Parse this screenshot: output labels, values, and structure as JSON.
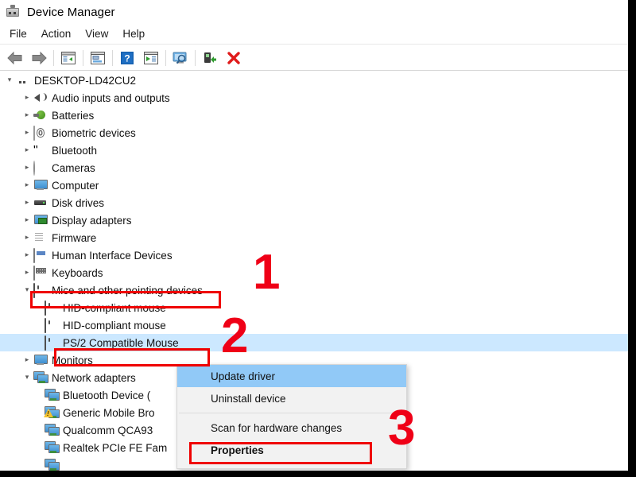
{
  "window": {
    "title": "Device Manager",
    "app_icon": "device-manager-icon"
  },
  "menubar": {
    "items": [
      {
        "label": "File"
      },
      {
        "label": "Action"
      },
      {
        "label": "View"
      },
      {
        "label": "Help"
      }
    ]
  },
  "toolbar": {
    "buttons": [
      {
        "icon": "back-arrow-icon",
        "label": "Back"
      },
      {
        "icon": "forward-arrow-icon",
        "label": "Forward"
      },
      {
        "icon": "show-hide-console-tree-icon",
        "label": "Show/Hide Console Tree"
      },
      {
        "icon": "properties-icon",
        "label": "Properties"
      },
      {
        "icon": "help-icon",
        "label": "Help"
      },
      {
        "icon": "update-driver-icon",
        "label": "Update Driver Software"
      },
      {
        "icon": "scan-hardware-changes-icon",
        "label": "Scan for hardware changes"
      },
      {
        "icon": "enable-device-icon",
        "label": "Enable device"
      },
      {
        "icon": "uninstall-device-icon",
        "label": "Uninstall device"
      }
    ]
  },
  "tree": {
    "root": {
      "label": "DESKTOP-LD42CU2",
      "icon": "computer-root-icon",
      "expanded": true
    },
    "items": [
      {
        "label": "Audio inputs and outputs",
        "icon": "speaker-icon",
        "depth": 1,
        "expanded": false
      },
      {
        "label": "Batteries",
        "icon": "battery-icon",
        "depth": 1,
        "expanded": false
      },
      {
        "label": "Biometric devices",
        "icon": "biometric-icon",
        "depth": 1,
        "expanded": false
      },
      {
        "label": "Bluetooth",
        "icon": "bluetooth-icon",
        "depth": 1,
        "expanded": false
      },
      {
        "label": "Cameras",
        "icon": "camera-icon",
        "depth": 1,
        "expanded": false
      },
      {
        "label": "Computer",
        "icon": "monitor-icon",
        "depth": 1,
        "expanded": false
      },
      {
        "label": "Disk drives",
        "icon": "disk-icon",
        "depth": 1,
        "expanded": false
      },
      {
        "label": "Display adapters",
        "icon": "display-adapter-icon",
        "depth": 1,
        "expanded": false
      },
      {
        "label": "Firmware",
        "icon": "firmware-icon",
        "depth": 1,
        "expanded": false
      },
      {
        "label": "Human Interface Devices",
        "icon": "hid-icon",
        "depth": 1,
        "expanded": false
      },
      {
        "label": "Keyboards",
        "icon": "keyboard-icon",
        "depth": 1,
        "expanded": false
      },
      {
        "label": "Mice and other pointing devices",
        "icon": "mouse-icon",
        "depth": 1,
        "expanded": true,
        "highlighted_box": true
      },
      {
        "label": "HID-compliant mouse",
        "icon": "mouse-icon",
        "depth": 2,
        "expanded": null
      },
      {
        "label": "HID-compliant mouse",
        "icon": "mouse-icon",
        "depth": 2,
        "expanded": null
      },
      {
        "label": "PS/2 Compatible Mouse",
        "icon": "mouse-icon",
        "depth": 2,
        "expanded": null,
        "selected": true,
        "highlighted_box": true
      },
      {
        "label": "Monitors",
        "icon": "monitor-icon",
        "depth": 1,
        "expanded": false
      },
      {
        "label": "Network adapters",
        "icon": "network-icon",
        "depth": 1,
        "expanded": true
      },
      {
        "label": "Bluetooth Device (",
        "icon": "network-icon",
        "depth": 2,
        "expanded": null
      },
      {
        "label": "Generic Mobile Bro",
        "icon": "network-icon",
        "depth": 2,
        "expanded": null,
        "warning": true
      },
      {
        "label": "Qualcomm QCA93",
        "icon": "network-icon",
        "depth": 2,
        "expanded": null
      },
      {
        "label": "Realtek PCIe FE Fam",
        "icon": "network-icon",
        "depth": 2,
        "expanded": null
      },
      {
        "label": "",
        "icon": "network-icon",
        "depth": 2,
        "expanded": null
      }
    ]
  },
  "context_menu": {
    "items": [
      {
        "label": "Update driver",
        "highlighted": true,
        "bold": false
      },
      {
        "label": "Uninstall device",
        "highlighted": false,
        "bold": false
      },
      {
        "separator": true
      },
      {
        "label": "Scan for hardware changes",
        "highlighted": false,
        "bold": false
      },
      {
        "label": "Properties",
        "highlighted": false,
        "bold": true,
        "highlighted_box": true
      }
    ]
  },
  "annotations": {
    "accent_color": "#ef0017",
    "steps": [
      {
        "number": "1"
      },
      {
        "number": "2"
      },
      {
        "number": "3"
      }
    ]
  }
}
